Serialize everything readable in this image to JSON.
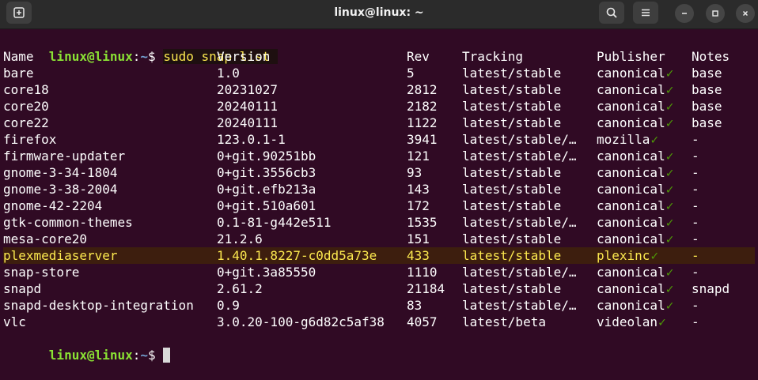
{
  "window": {
    "title": "linux@linux: ~"
  },
  "prompt": {
    "user": "linux@linux",
    "colon": ":",
    "path": "~",
    "dollar": "$ ",
    "command": "sudo snap list "
  },
  "table": {
    "headers": [
      "Name",
      "Version",
      "Rev",
      "Tracking",
      "Publisher",
      "Notes"
    ],
    "rows": [
      {
        "name": "bare",
        "version": "1.0",
        "rev": "5",
        "tracking": "latest/stable",
        "publisher": "canonical",
        "check": "✓",
        "notes": "base"
      },
      {
        "name": "core18",
        "version": "20231027",
        "rev": "2812",
        "tracking": "latest/stable",
        "publisher": "canonical",
        "check": "✓",
        "notes": "base"
      },
      {
        "name": "core20",
        "version": "20240111",
        "rev": "2182",
        "tracking": "latest/stable",
        "publisher": "canonical",
        "check": "✓",
        "notes": "base"
      },
      {
        "name": "core22",
        "version": "20240111",
        "rev": "1122",
        "tracking": "latest/stable",
        "publisher": "canonical",
        "check": "✓",
        "notes": "base"
      },
      {
        "name": "firefox",
        "version": "123.0.1-1",
        "rev": "3941",
        "tracking": "latest/stable/…",
        "publisher": "mozilla",
        "check": "✓",
        "notes": "-"
      },
      {
        "name": "firmware-updater",
        "version": "0+git.90251bb",
        "rev": "121",
        "tracking": "latest/stable/…",
        "publisher": "canonical",
        "check": "✓",
        "notes": "-"
      },
      {
        "name": "gnome-3-34-1804",
        "version": "0+git.3556cb3",
        "rev": "93",
        "tracking": "latest/stable",
        "publisher": "canonical",
        "check": "✓",
        "notes": "-"
      },
      {
        "name": "gnome-3-38-2004",
        "version": "0+git.efb213a",
        "rev": "143",
        "tracking": "latest/stable",
        "publisher": "canonical",
        "check": "✓",
        "notes": "-"
      },
      {
        "name": "gnome-42-2204",
        "version": "0+git.510a601",
        "rev": "172",
        "tracking": "latest/stable",
        "publisher": "canonical",
        "check": "✓",
        "notes": "-"
      },
      {
        "name": "gtk-common-themes",
        "version": "0.1-81-g442e511",
        "rev": "1535",
        "tracking": "latest/stable/…",
        "publisher": "canonical",
        "check": "✓",
        "notes": "-"
      },
      {
        "name": "mesa-core20",
        "version": "21.2.6",
        "rev": "151",
        "tracking": "latest/stable",
        "publisher": "canonical",
        "check": "✓",
        "notes": "-"
      },
      {
        "name": "plexmediaserver",
        "version": "1.40.1.8227-c0dd5a73e",
        "rev": "433",
        "tracking": "latest/stable",
        "publisher": "plexinc",
        "check": "✓",
        "notes": "-"
      },
      {
        "name": "snap-store",
        "version": "0+git.3a85550",
        "rev": "1110",
        "tracking": "latest/stable/…",
        "publisher": "canonical",
        "check": "✓",
        "notes": "-"
      },
      {
        "name": "snapd",
        "version": "2.61.2",
        "rev": "21184",
        "tracking": "latest/stable",
        "publisher": "canonical",
        "check": "✓",
        "notes": "snapd"
      },
      {
        "name": "snapd-desktop-integration",
        "version": "0.9",
        "rev": "83",
        "tracking": "latest/stable/…",
        "publisher": "canonical",
        "check": "✓",
        "notes": "-"
      },
      {
        "name": "vlc",
        "version": "3.0.20-100-g6d82c5af38",
        "rev": "4057",
        "tracking": "latest/beta",
        "publisher": "videolan",
        "check": "✓",
        "notes": "-"
      }
    ]
  },
  "colors": {
    "background": "#300a24",
    "prompt_user": "#8ae234",
    "prompt_path": "#729fcf",
    "highlight_text": "#fce94f",
    "check": "#4e9a06"
  }
}
